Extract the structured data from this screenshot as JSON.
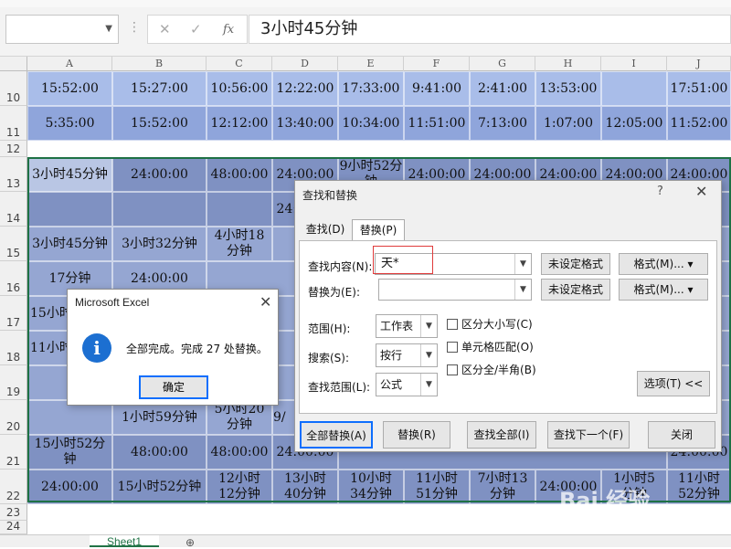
{
  "formula_bar": {
    "name_box": "",
    "fx": "fx",
    "cancel": "✕",
    "enter": "✓",
    "formula": "3小时45分钟"
  },
  "columns": [
    "A",
    "B",
    "C",
    "D",
    "E",
    "F",
    "G",
    "H",
    "I",
    "J"
  ],
  "rows": {
    "r10": [
      "15:52:00",
      "15:27:00",
      "10:56:00",
      "12:22:00",
      "17:33:00",
      "9:41:00",
      "2:41:00",
      "13:53:00",
      "",
      "17:51:00"
    ],
    "r11": [
      "5:35:00",
      "15:52:00",
      "12:12:00",
      "13:40:00",
      "10:34:00",
      "11:51:00",
      "7:13:00",
      "1:07:00",
      "12:05:00",
      "11:52:00"
    ],
    "r13": [
      "3小时45分钟",
      "24:00:00",
      "48:00:00",
      "24:00:00",
      "9小时52分钟",
      "24:00:00",
      "24:00:00",
      "24:00:00",
      "24:00:00",
      "24:00:00"
    ],
    "r14": [
      "",
      "",
      "",
      "24:00:00",
      "",
      "",
      "",
      "",
      "",
      ""
    ],
    "r15": [
      "3小时45分钟",
      "3小时32分钟",
      "4小时18分钟"
    ],
    "r16": [
      "17分钟",
      "24:00:00"
    ],
    "r17": [
      "15小时"
    ],
    "r18": [
      "11小时"
    ],
    "r20": [
      "",
      "1小时59分钟",
      "5小时20分钟",
      "9/"
    ],
    "r21": [
      "15小时52分钟",
      "48:00:00",
      "48:00:00",
      "24:00:00",
      "",
      "",
      "",
      "",
      "",
      "24:00:00"
    ],
    "r22": [
      "24:00:00",
      "15小时52分钟",
      "12小时12分钟",
      "13小时40分钟",
      "10小时34分钟",
      "11小时51分钟",
      "7小时13分钟",
      "24:00:00",
      "1小时5分钟",
      "11小时52分钟"
    ]
  },
  "row_numbers": [
    "10",
    "11",
    "12",
    "13",
    "14",
    "15",
    "16",
    "17",
    "18",
    "19",
    "20",
    "21",
    "22",
    "23",
    "24"
  ],
  "sheet_tab": "Sheet1",
  "find_replace": {
    "title": "查找和替换",
    "help": "?",
    "close": "✕",
    "tab_find": "查找(D)",
    "tab_replace": "替换(P)",
    "find_label": "查找内容(N):",
    "find_value": "天*",
    "replace_label": "替换为(E):",
    "replace_value": "",
    "no_format": "未设定格式",
    "format_btn": "格式(M)...",
    "scope_label": "范围(H):",
    "scope_value": "工作表",
    "search_label": "搜索(S):",
    "search_value": "按行",
    "lookin_label": "查找范围(L):",
    "lookin_value": "公式",
    "match_case": "区分大小写(C)",
    "match_cell": "单元格匹配(O)",
    "match_width": "区分全/半角(B)",
    "options_btn": "选项(T) <<",
    "replace_all": "全部替换(A)",
    "replace": "替换(R)",
    "find_all": "查找全部(I)",
    "find_next": "查找下一个(F)",
    "close_btn": "关闭"
  },
  "msgbox": {
    "title": "Microsoft Excel",
    "close": "✕",
    "message": "全部完成。完成 27 处替换。",
    "ok": "确定"
  },
  "watermark": {
    "main": "Bai 经验",
    "sub": "jingyan.baidu.com"
  }
}
